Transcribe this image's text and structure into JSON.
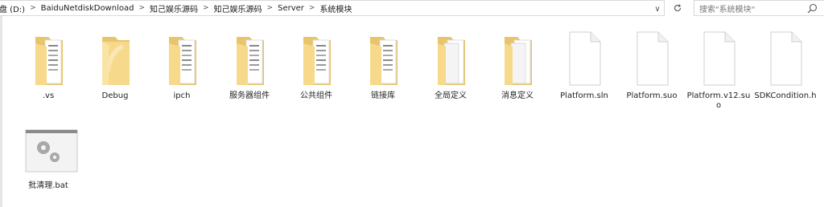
{
  "address_bar": {
    "breadcrumbs": [
      {
        "label": "盘 (D:)"
      },
      {
        "label": "BaiduNetdiskDownload"
      },
      {
        "label": "知己娱乐源码"
      },
      {
        "label": "知己娱乐源码"
      },
      {
        "label": "Server"
      },
      {
        "label": "系统模块"
      }
    ],
    "separator": ">",
    "dropdown_glyph": "∨"
  },
  "search": {
    "placeholder": "搜索\"系统模块\"",
    "icon": "search-icon"
  },
  "items": [
    {
      "label": ".vs",
      "type": "folder-docs"
    },
    {
      "label": "Debug",
      "type": "folder-plain"
    },
    {
      "label": "ipch",
      "type": "folder-docs"
    },
    {
      "label": "服务器组件",
      "type": "folder-docs"
    },
    {
      "label": "公共组件",
      "type": "folder-docs"
    },
    {
      "label": "链接库",
      "type": "folder-docs"
    },
    {
      "label": "全局定义",
      "type": "folder-pages"
    },
    {
      "label": "消息定义",
      "type": "folder-pages"
    },
    {
      "label": "Platform.sln",
      "type": "file"
    },
    {
      "label": "Platform.suo",
      "type": "file"
    },
    {
      "label": "Platform.v12.suo",
      "type": "file"
    },
    {
      "label": "SDKCondition.h",
      "type": "file"
    },
    {
      "label": "批清理.bat",
      "type": "batch"
    }
  ],
  "colors": {
    "folder_back": "#e8c46a",
    "folder_front": "#f6d98a",
    "file_border": "#cfcfcf"
  }
}
